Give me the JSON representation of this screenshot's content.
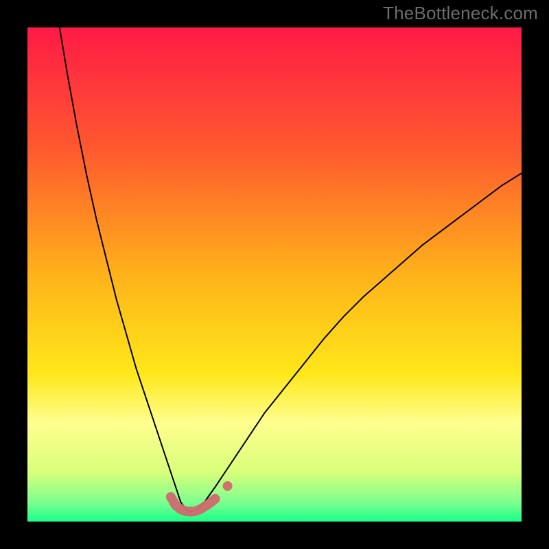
{
  "watermark": "TheBottleneck.com",
  "svg": {
    "view_w": 720,
    "view_h": 720
  },
  "chart_data": {
    "type": "line",
    "title": "",
    "xlabel": "",
    "ylabel": "",
    "xlim": [
      0,
      100
    ],
    "ylim": [
      0,
      100
    ],
    "grid": false,
    "legend": false,
    "background_gradient": {
      "orientation": "vertical",
      "stops": [
        {
          "pct": 0.0,
          "color": "#ff1a46"
        },
        {
          "pct": 0.25,
          "color": "#ff5a2e"
        },
        {
          "pct": 0.5,
          "color": "#ffb21a"
        },
        {
          "pct": 0.7,
          "color": "#ffe71a"
        },
        {
          "pct": 0.8,
          "color": "#ffff8f"
        },
        {
          "pct": 0.9,
          "color": "#d9ff7a"
        },
        {
          "pct": 0.96,
          "color": "#7fff8f"
        },
        {
          "pct": 1.0,
          "color": "#1aff8a"
        }
      ]
    },
    "series": [
      {
        "name": "bottleneck-curve",
        "role": "main",
        "color": "#000000",
        "width": 2,
        "notes": "V-shaped curve; deep minimum near x≈33; both branches rise steeply, left branch hits top edge, right branch tapers toward upper right.",
        "x": [
          6.5,
          8,
          10,
          12,
          14,
          16,
          18,
          20,
          22,
          24,
          26,
          28,
          30,
          31,
          32,
          33,
          34,
          35,
          36,
          38,
          40,
          44,
          48,
          52,
          56,
          60,
          64,
          68,
          72,
          76,
          80,
          84,
          88,
          92,
          96,
          100
        ],
        "y": [
          100,
          91,
          80,
          70,
          61,
          53,
          45,
          38,
          31,
          25,
          19,
          13,
          7,
          4,
          2.5,
          2,
          2.2,
          3,
          4.2,
          7,
          10,
          16,
          22,
          27,
          32,
          37,
          41.5,
          45.5,
          49,
          52.5,
          56,
          59,
          62,
          65,
          68,
          70.5
        ]
      },
      {
        "name": "highlight-band",
        "role": "annotation",
        "color": "#cf6a6f",
        "width": 14,
        "linecap": "round",
        "notes": "Thick pink band marking the flat minimum of the curve.",
        "x": [
          29,
          30,
          31,
          32,
          33,
          34,
          35,
          36,
          37,
          38
        ],
        "y": [
          5.0,
          3.3,
          2.5,
          2.1,
          2.0,
          2.1,
          2.5,
          3.1,
          3.8,
          4.6
        ]
      },
      {
        "name": "right-step-dot",
        "role": "annotation-point",
        "color": "#cf6a6f",
        "radius": 7,
        "x": [
          40.5
        ],
        "y": [
          7.2
        ]
      }
    ]
  }
}
